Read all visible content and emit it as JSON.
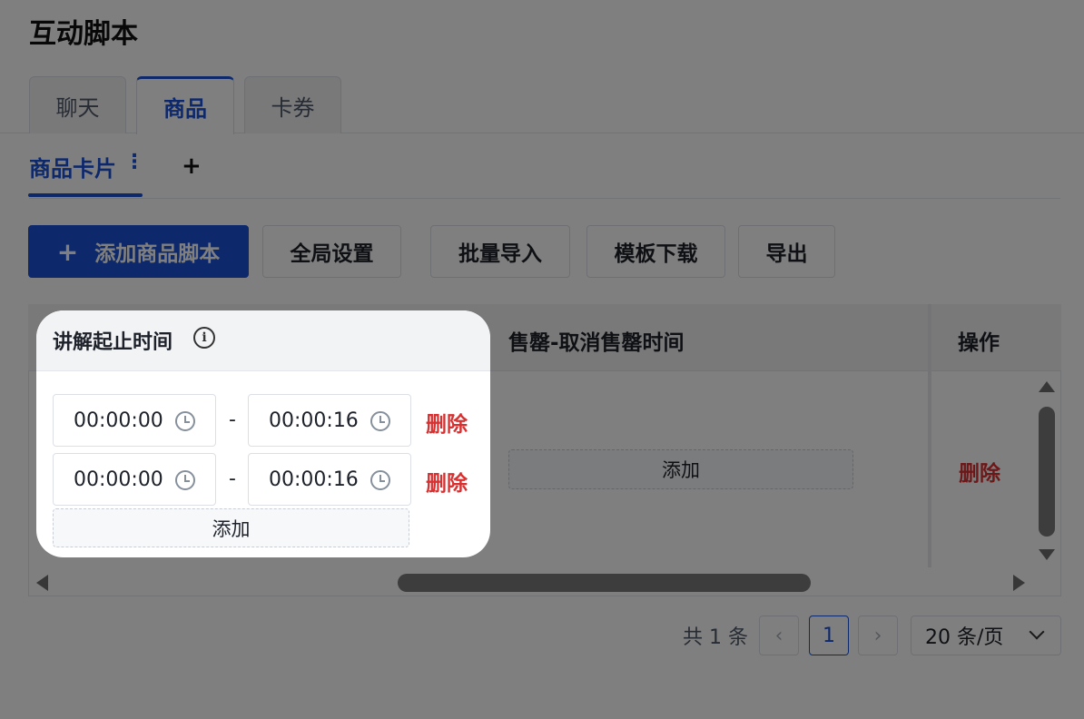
{
  "page": {
    "title": "互动脚本"
  },
  "tabs": [
    {
      "label": "聊天"
    },
    {
      "label": "商品"
    },
    {
      "label": "卡券"
    }
  ],
  "subtab": {
    "label": "商品卡片",
    "more": "⋮",
    "add": "+"
  },
  "toolbar": {
    "add_script_plus": "+",
    "add_script": "添加商品脚本",
    "global_settings": "全局设置",
    "batch_import": "批量导入",
    "template_download": "模板下载",
    "export": "导出"
  },
  "table": {
    "columns": {
      "explain_time": "讲解起止时间",
      "sold_out_time": "售罄-取消售罄时间",
      "actions": "操作"
    },
    "row": {
      "sold_out_add": "添加",
      "delete": "删除"
    }
  },
  "spotlight": {
    "title": "讲解起止时间",
    "info_icon": "i",
    "ranges": [
      {
        "start": "00:00:00",
        "separator": "-",
        "end": "00:00:16",
        "delete": "删除"
      },
      {
        "start": "00:00:00",
        "separator": "-",
        "end": "00:00:16",
        "delete": "删除"
      }
    ],
    "add": "添加"
  },
  "pagination": {
    "total": "共 1 条",
    "prev": "‹",
    "current": "1",
    "next": "›",
    "page_size": "20 条/页"
  },
  "colors": {
    "primary": "#1a52d8",
    "danger": "#d83131"
  }
}
